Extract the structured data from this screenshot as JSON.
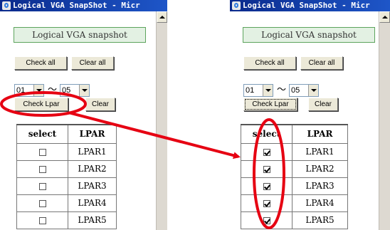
{
  "left": {
    "window_title": "Logical VGA SnapShot - Micr",
    "section_title": "Logical VGA snapshot",
    "check_all_label": "Check all",
    "clear_all_label": "Clear all",
    "range_from": "01",
    "range_sep": "〜",
    "range_to": "05",
    "check_lpar_label": "Check Lpar",
    "clear_label": "Clear",
    "table": {
      "headers": [
        "select",
        "LPAR"
      ],
      "rows": [
        {
          "lpar": "LPAR1",
          "checked": false
        },
        {
          "lpar": "LPAR2",
          "checked": false
        },
        {
          "lpar": "LPAR3",
          "checked": false
        },
        {
          "lpar": "LPAR4",
          "checked": false
        },
        {
          "lpar": "LPAR5",
          "checked": false
        }
      ]
    }
  },
  "right": {
    "window_title": "Logical VGA SnapShot - Micr",
    "section_title": "Logical VGA snapshot",
    "check_all_label": "Check all",
    "clear_all_label": "Clear all",
    "range_from": "01",
    "range_sep": "〜",
    "range_to": "05",
    "check_lpar_label": "Check Lpar",
    "clear_label": "Clear",
    "table": {
      "headers": [
        "select",
        "LPAR"
      ],
      "rows": [
        {
          "lpar": "LPAR1",
          "checked": true
        },
        {
          "lpar": "LPAR2",
          "checked": true
        },
        {
          "lpar": "LPAR3",
          "checked": true
        },
        {
          "lpar": "LPAR4",
          "checked": true
        },
        {
          "lpar": "LPAR5",
          "checked": true
        }
      ]
    }
  },
  "colors": {
    "annotation_red": "#e60012",
    "title_bar": "#0a2a8c",
    "section_fill": "#e3f1e3",
    "section_border": "#5da45d"
  },
  "icons": [
    "ie-icon",
    "scroll-up-icon",
    "dropdown-arrow-icon",
    "checkbox-icon"
  ]
}
